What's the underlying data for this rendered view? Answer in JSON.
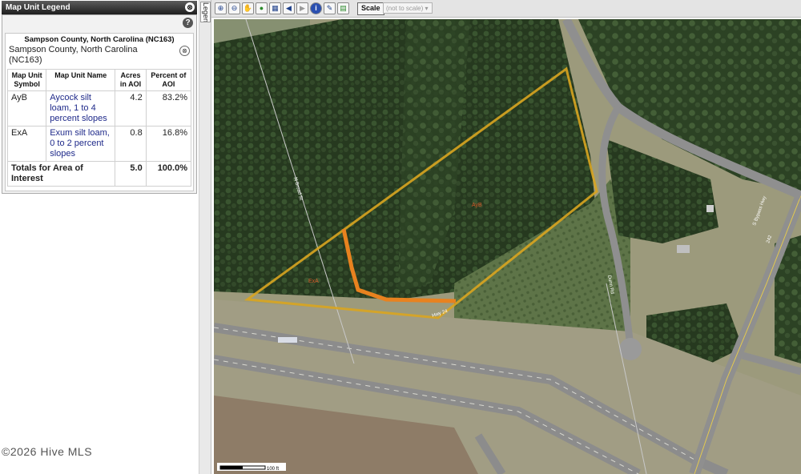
{
  "legend": {
    "header_title": "Map Unit Legend",
    "collapse_glyph": "⊗",
    "help_glyph": "?",
    "county_title": "Sampson County, North Carolina (NC163)",
    "county_subtitle": "Sampson County, North Carolina (NC163)",
    "county_toggle_glyph": "⊗",
    "columns": [
      "Map Unit Symbol",
      "Map Unit Name",
      "Acres in AOI",
      "Percent of AOI"
    ],
    "rows": [
      {
        "symbol": "AyB",
        "name": "Aycock silt loam, 1 to 4 percent slopes",
        "acres": "4.2",
        "percent": "83.2%"
      },
      {
        "symbol": "ExA",
        "name": "Exum silt loam, 0 to 2 percent slopes",
        "acres": "0.8",
        "percent": "16.8%"
      }
    ],
    "totals": {
      "label": "Totals for Area of Interest",
      "acres": "5.0",
      "percent": "100.0%"
    }
  },
  "side_tab": {
    "label": "Legend"
  },
  "toolbar": {
    "tools": [
      {
        "name": "zoom-in-icon",
        "glyph": "⊕"
      },
      {
        "name": "zoom-out-icon",
        "glyph": "⊖"
      },
      {
        "name": "pan-hand-icon",
        "glyph": "✋"
      },
      {
        "name": "globe-icon",
        "glyph": "●"
      },
      {
        "name": "aoi-icon",
        "glyph": "▦"
      },
      {
        "name": "back-arrow-icon",
        "glyph": "◀"
      },
      {
        "name": "forward-arrow-icon",
        "glyph": "▶"
      },
      {
        "name": "info-icon",
        "glyph": "i"
      },
      {
        "name": "pencil-icon",
        "glyph": "✎"
      },
      {
        "name": "print-icon",
        "glyph": "▤"
      }
    ],
    "scale_label": "Scale",
    "scale_value": "(not to scale)"
  },
  "map": {
    "labels": {
      "ayb": "AyB",
      "exa": "ExA",
      "road_broad": "N Broad St",
      "road_hwy": "Hwy 24",
      "road_dunn": "Dunn Rd",
      "road_bypass": "S Bypass Hwy",
      "road_242": "242"
    },
    "scale_bar_label": "100 ft",
    "colors": {
      "aoi_outline": "#d9a520",
      "unit_boundary": "#e8821f"
    }
  },
  "watermark": "©2026 Hive MLS"
}
